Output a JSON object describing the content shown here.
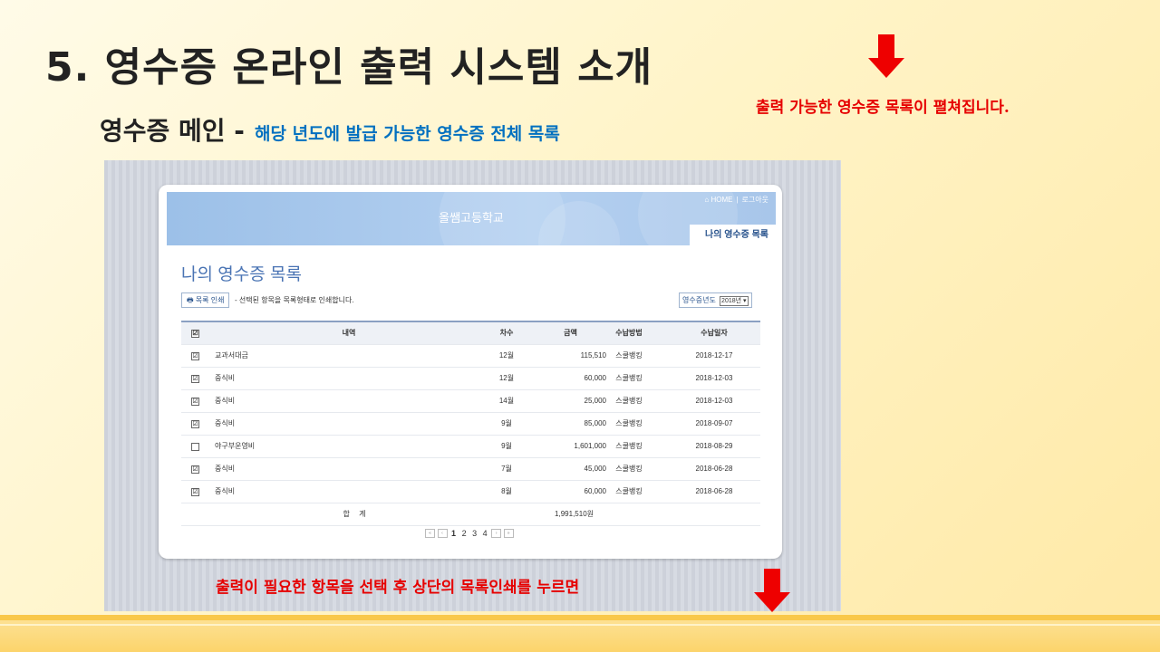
{
  "slide": {
    "title": "5. 영수증 온라인 출력 시스템 소개",
    "subtitle": "영수증 메인 -",
    "subtitle_desc": "해당 년도에 발급 가능한 영수증 전체 목록",
    "note_top": "출력 가능한 영수증 목록이 펼쳐집니다.",
    "note_bottom": "출력이 필요한 항목을 선택 후 상단의 목록인쇄를 누르면",
    "colors": {
      "note": "#e60000",
      "desc": "#0070c0",
      "arrow": "#ee0000"
    }
  },
  "site": {
    "school_name": "올쌤고등학교",
    "home_link": "⌂ HOME",
    "divider": "|",
    "logout_link": "로그아웃",
    "menu_tab": "나의 영수증 목록",
    "page_title": "나의 영수증 목록",
    "print_button": "목록 인쇄",
    "print_icon": "printer-icon",
    "print_note": "- 선택된 항목을 목록형태로 인쇄합니다.",
    "year_label": "영수증년도",
    "year_value": "2018년"
  },
  "table": {
    "headers": {
      "check": "☑",
      "name": "내역",
      "times": "차수",
      "amount": "금액",
      "method": "수납방법",
      "date": "수납일자"
    },
    "rows": [
      {
        "check": "☑",
        "name": "교과서대금",
        "times": "12월",
        "amount": "115,510",
        "method": "스쿨뱅킹",
        "date": "2018-12-17"
      },
      {
        "check": "☑",
        "name": "중식비",
        "times": "12월",
        "amount": "60,000",
        "method": "스쿨뱅킹",
        "date": "2018-12-03"
      },
      {
        "check": "☑",
        "name": "중식비",
        "times": "14월",
        "amount": "25,000",
        "method": "스쿨뱅킹",
        "date": "2018-12-03"
      },
      {
        "check": "☑",
        "name": "중식비",
        "times": "9월",
        "amount": "85,000",
        "method": "스쿨뱅킹",
        "date": "2018-09-07"
      },
      {
        "check": "",
        "name": "야구부운영비",
        "times": "9월",
        "amount": "1,601,000",
        "method": "스쿨뱅킹",
        "date": "2018-08-29"
      },
      {
        "check": "☑",
        "name": "중식비",
        "times": "7월",
        "amount": "45,000",
        "method": "스쿨뱅킹",
        "date": "2018-06-28"
      },
      {
        "check": "☑",
        "name": "중식비",
        "times": "8월",
        "amount": "60,000",
        "method": "스쿨뱅킹",
        "date": "2018-06-28"
      }
    ],
    "total_label": "합 계",
    "total_value": "1,991,510원"
  },
  "pagination": {
    "first": "«",
    "prev": "‹",
    "next": "›",
    "last": "»",
    "pages": [
      "1",
      "2",
      "3",
      "4"
    ]
  }
}
